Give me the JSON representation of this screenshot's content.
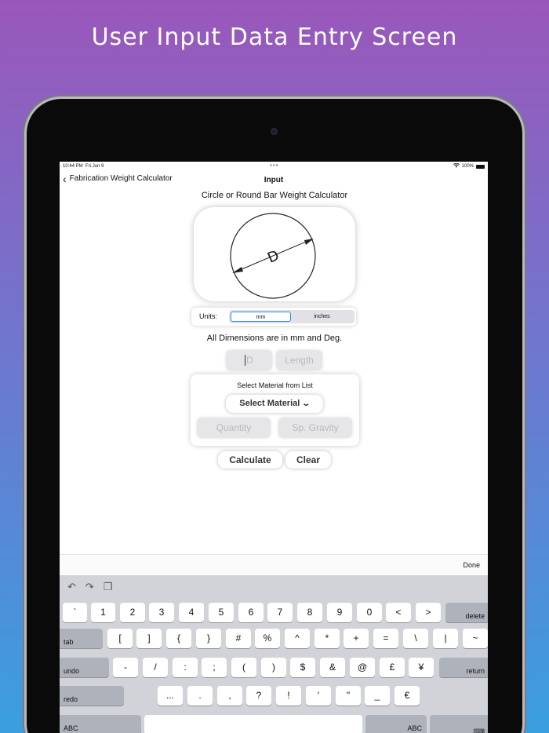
{
  "headline": "User Input Data Entry Screen",
  "status": {
    "time": "10:44 PM",
    "date": "Fri Jun 9",
    "battery": "100%"
  },
  "nav": {
    "back_label": "Fabrication Weight Calculator",
    "title": "Input"
  },
  "calculator_title": "Circle or Round Bar Weight Calculator",
  "diagram": {
    "label": "D"
  },
  "units": {
    "label": "Units:",
    "options": [
      "mm",
      "inches"
    ],
    "selected": "mm"
  },
  "dims_note": "All Dimensions are in mm and Deg.",
  "inputs": {
    "d_placeholder": "D",
    "length_placeholder": "Length",
    "quantity_placeholder": "Quantity",
    "gravity_placeholder": "Sp. Gravity"
  },
  "material": {
    "title": "Select Material from List",
    "select_label": "Select Material"
  },
  "buttons": {
    "calculate": "Calculate",
    "clear": "Clear"
  },
  "accessory": {
    "done": "Done"
  },
  "keyboard": {
    "row1": [
      "`",
      "1",
      "2",
      "3",
      "4",
      "5",
      "6",
      "7",
      "8",
      "9",
      "0",
      "<",
      ">"
    ],
    "delete": "delete",
    "tab": "tab",
    "row2": [
      "[",
      "]",
      "{",
      "}",
      "#",
      "%",
      "^",
      "*",
      "+",
      "=",
      "\\",
      "|",
      "~"
    ],
    "undo": "undo",
    "row3": [
      "-",
      "/",
      ":",
      ";",
      "(",
      ")",
      "$",
      "&",
      "@",
      "£",
      "¥"
    ],
    "return": "return",
    "redo": "redo",
    "row4": [
      "...",
      ".",
      ",",
      "?",
      "!",
      "'",
      "\"",
      "_",
      "€"
    ],
    "abc": "ABC"
  }
}
